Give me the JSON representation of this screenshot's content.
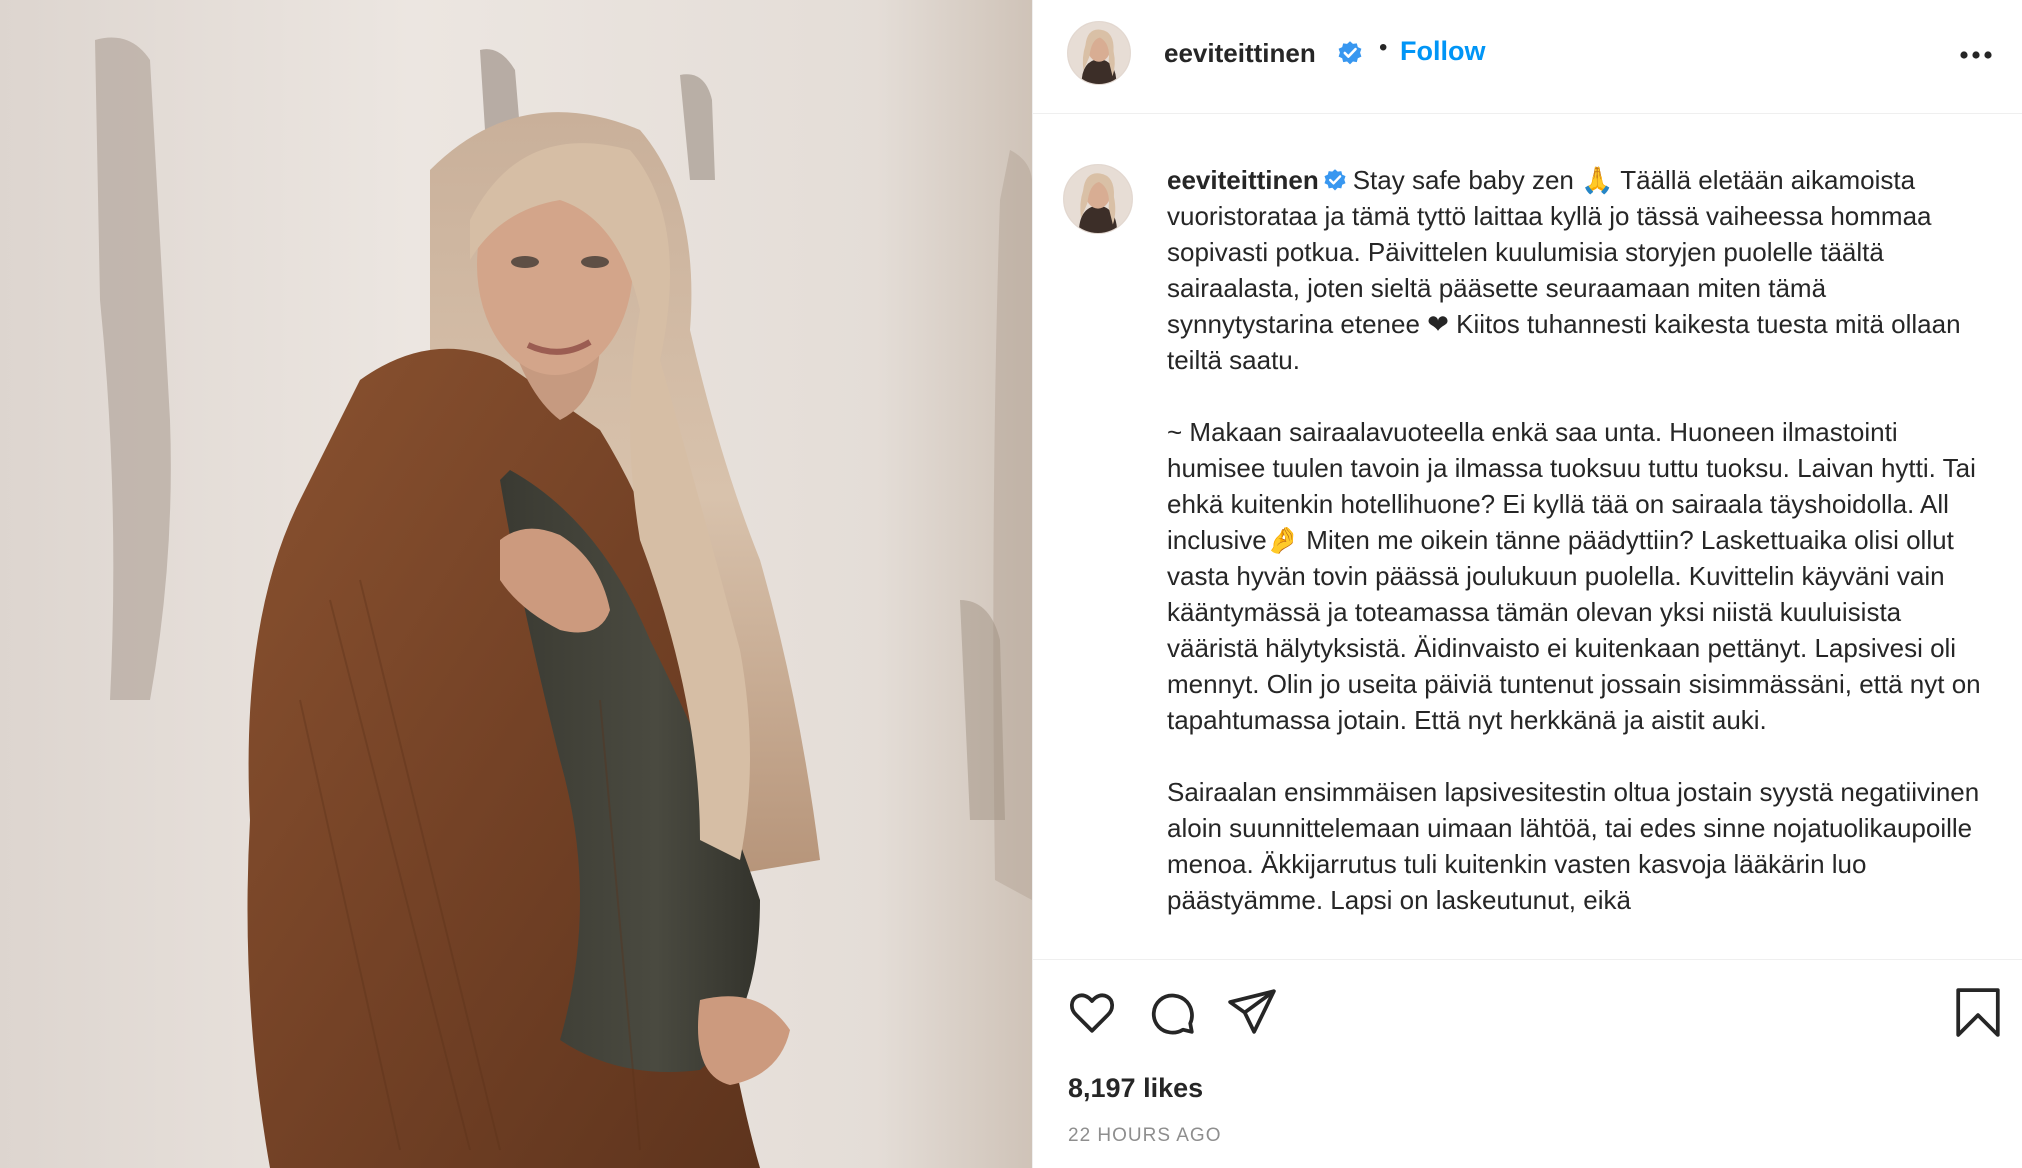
{
  "header": {
    "username": "eeviteittinen",
    "separator": "•",
    "follow_label": "Follow"
  },
  "caption": {
    "username": "eeviteittinen",
    "paragraph_1": "Stay safe baby zen 🙏 Täällä eletään aikamoista vuoristorataa ja tämä tyttö laittaa kyllä jo tässä vaiheessa hommaa sopivasti potkua. Päivittelen kuulumisia storyjen puolelle täältä sairaalasta, joten sieltä pääsette seuraamaan miten tämä synnytystarina etenee ❤ Kiitos tuhannesti kaikesta tuesta mitä ollaan teiltä saatu.",
    "paragraph_2": "~ Makaan sairaalavuoteella enkä saa unta. Huoneen ilmastointi humisee tuulen tavoin ja ilmassa tuoksuu tuttu tuoksu. Laivan hytti. Tai ehkä kuitenkin hotellihuone? Ei kyllä tää on sairaala täyshoidolla. All inclusive🤌 Miten me oikein tänne päädyttiin? Laskettuaika olisi ollut vasta hyvän tovin päässä joulukuun puolella. Kuvittelin käyväni vain kääntymässä ja toteamassa tämän olevan yksi niistä kuuluisista vääristä hälytyksistä. Äidinvaisto ei kuitenkaan pettänyt. Lapsivesi oli mennyt. Olin jo useita päiviä tuntenut jossain sisimmässäni, että nyt on tapahtumassa jotain. Että nyt herkkänä ja aistit auki.",
    "paragraph_3": "Sairaalan ensimmäisen lapsivesitestin oltua jostain syystä negatiivinen aloin suunnittelemaan uimaan lähtöä, tai edes sinne nojatuolikaupoille menoa. Äkkijarrutus tuli kuitenkin vasten kasvoja lääkärin luo päästyämme. Lapsi on laskeutunut, eikä"
  },
  "actions": {
    "like_icon": "heart-icon",
    "comment_icon": "comment-icon",
    "share_icon": "paper-plane-icon",
    "save_icon": "bookmark-icon"
  },
  "likes": "8,197 likes",
  "timestamp": "22 HOURS AGO",
  "colors": {
    "link_blue": "#0095f6",
    "verified_blue": "#3897f0",
    "text": "#262626",
    "muted": "#8e8e8e",
    "divider": "#efefef",
    "cardigan_brown": "#7a4527"
  }
}
